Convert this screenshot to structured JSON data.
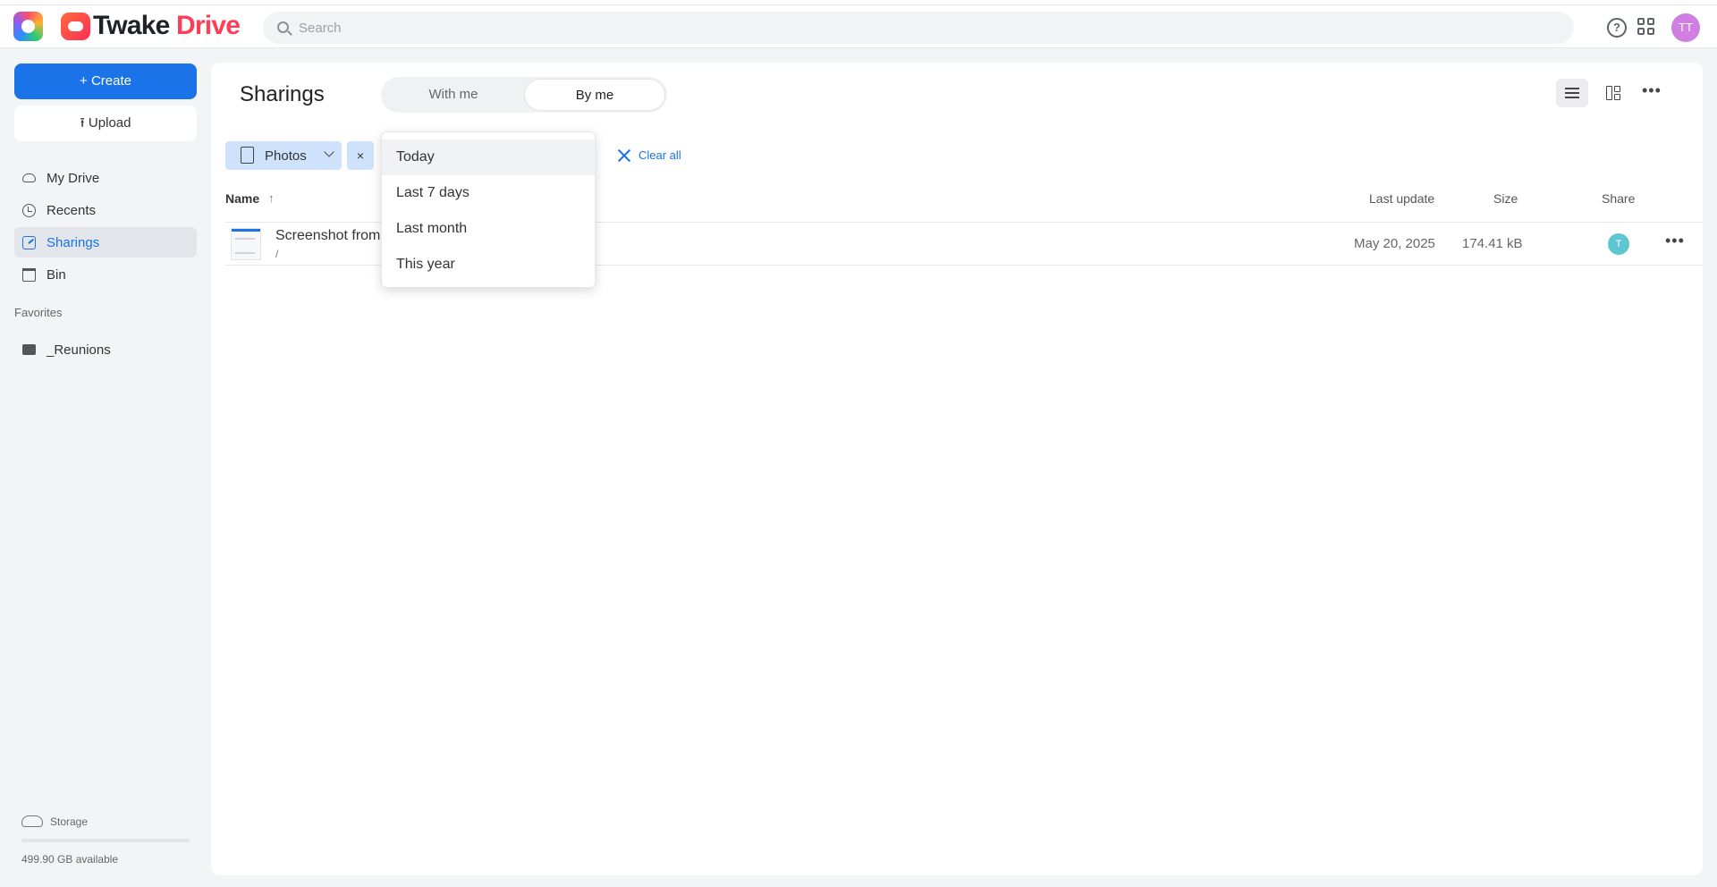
{
  "header": {
    "brand_part1": "Twake",
    "brand_part2": "Drive",
    "search_placeholder": "Search",
    "user_initials": "TT",
    "help_glyph": "?"
  },
  "sidebar": {
    "create_label": "+ Create",
    "upload_label": "⭱ Upload",
    "items": [
      {
        "label": "My Drive",
        "icon": "cloud-icon"
      },
      {
        "label": "Recents",
        "icon": "clock-icon"
      },
      {
        "label": "Sharings",
        "icon": "share-icon",
        "active": true
      },
      {
        "label": "Bin",
        "icon": "trash-icon"
      }
    ],
    "favorites_title": "Favorites",
    "favorites": [
      {
        "label": "_Reunions",
        "icon": "folder-icon"
      }
    ],
    "storage": {
      "label": "Storage",
      "available": "499.90 GB available",
      "used_fraction": 0.0
    }
  },
  "main": {
    "title": "Sharings",
    "tabs": [
      {
        "label": "With me",
        "active": false
      },
      {
        "label": "By me",
        "active": true
      }
    ],
    "filter_chip": {
      "label": "Photos",
      "remove": "×"
    },
    "clear_all": "Clear all",
    "columns": {
      "name": "Name",
      "sort_indicator": "↑",
      "last_update": "Last update",
      "size": "Size",
      "share": "Share"
    },
    "rows": [
      {
        "name": "Screenshot from",
        "path": "/",
        "last_update": "May 20, 2025",
        "size": "174.41 kB",
        "share_initial": "T",
        "more": "•••"
      }
    ],
    "more_top": "•••"
  },
  "date_dropdown": {
    "options": [
      "Today",
      "Last 7 days",
      "Last month",
      "This year"
    ],
    "highlighted": "Today"
  },
  "colors": {
    "accent": "#1a73e8",
    "brand_red": "#ff3d57",
    "user_avatar": "#d17ee3",
    "share_avatar": "#5ec6d1"
  }
}
